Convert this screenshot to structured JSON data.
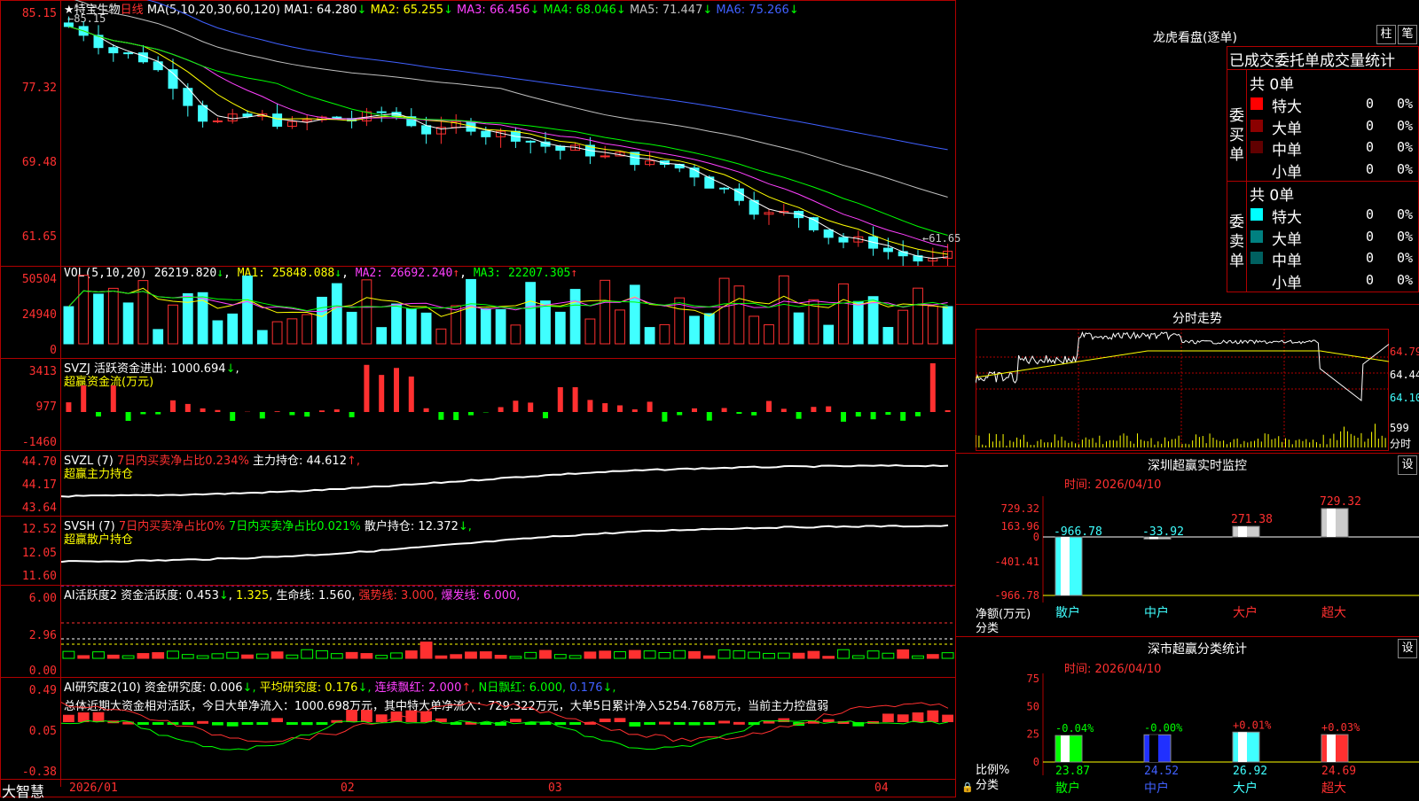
{
  "colors": {
    "up": "#ff3030",
    "down": "#40ffff",
    "bg": "#000000",
    "grid": "#b00000",
    "ma1": "#ffffff",
    "ma2": "#ffff00",
    "ma3": "#ff40ff",
    "ma4": "#00ff00",
    "ma5": "#c0c0c0",
    "ma6": "#4060ff"
  },
  "header": {
    "star": "★",
    "stock_name": "特宝生物",
    "period": "日线",
    "ma_params": "MA(5,10,20,30,60,120)",
    "ma_values": [
      {
        "label": "MA1:",
        "value": "64.280",
        "arrow": "↓"
      },
      {
        "label": "MA2:",
        "value": "65.255",
        "arrow": "↓"
      },
      {
        "label": "MA3:",
        "value": "66.456",
        "arrow": "↓"
      },
      {
        "label": "MA4:",
        "value": "68.046",
        "arrow": "↓"
      },
      {
        "label": "MA5:",
        "value": "71.447",
        "arrow": "↓"
      },
      {
        "label": "MA6:",
        "value": "75.266",
        "arrow": "↓"
      }
    ],
    "high_mark": "←85.15",
    "low_mark": "←61.65"
  },
  "price_axis": [
    "85.15",
    "77.32",
    "69.48",
    "61.65"
  ],
  "vol": {
    "title": "VOL(5,10,20)",
    "value": "26219.820",
    "arrow": "↓",
    "ma1": "MA1: 25848.088",
    "ma1_arrow": "↓",
    "ma2": "MA2: 26692.240",
    "ma2_arrow": "↑",
    "ma3": "MA3: 22207.305",
    "ma3_arrow": "↑",
    "axis": [
      "50504",
      "24940",
      "0"
    ]
  },
  "svzj": {
    "title": "SVZJ 活跃资金进出: 1000.694",
    "arrow": "↓",
    "sub": "超赢资金流(万元)",
    "axis": [
      "3413",
      "977",
      "-1460"
    ]
  },
  "svzl": {
    "title": "SVZL (7)",
    "t1": "7日内买卖净占比0.234%",
    "t2": "主力持仓: 44.612",
    "arrow": "↑,",
    "sub": "超赢主力持仓",
    "axis": [
      "44.70",
      "44.17",
      "43.64"
    ]
  },
  "svsh": {
    "title": "SVSH (7)",
    "t1": "7日内买卖净占比0%",
    "t2": "7日内买卖净占比0.021%",
    "t3": "散户持仓: 12.372",
    "arrow": "↓,",
    "sub": "超赢散户持仓",
    "axis": [
      "12.52",
      "12.05",
      "11.60"
    ]
  },
  "ai1": {
    "title": "AI活跃度2 资金活跃度: 0.453",
    "a1": "↓",
    "v2": "1.325",
    "v3": "生命线: 1.560,",
    "v4": "强势线: 3.000,",
    "v5": "爆发线: 6.000,",
    "axis": [
      "6.00",
      "2.96",
      "0.00"
    ]
  },
  "ai2": {
    "title": "AI研究度2(10) 资金研究度: 0.006",
    "a1": "↓,",
    "v2": "平均研究度: 0.176",
    "a2": "↓,",
    "v3": "连续飘红: 2.000",
    "a3": "↑,",
    "v4": "N日飘红: 6.000,",
    "v5": "0.176",
    "a5": "↓,",
    "summary": "总体近期大资金相对活跃，今日大单净流入：1000.698万元，其中特大单净流入：729.322万元，大单5日累计净入5254.768万元，当前主力控盘弱",
    "axis": [
      "0.49",
      "0.05",
      "-0.38"
    ]
  },
  "footer": {
    "brand": "大智慧",
    "dates": [
      "2026/01",
      "02",
      "03",
      "04"
    ]
  },
  "longhu": {
    "title": "龙虎看盘(逐单)",
    "btn1": "柱",
    "btn2": "笔",
    "header": "已成交委托单成交量统计",
    "buy": {
      "side": "委买单",
      "total": "共 0单",
      "rows": [
        {
          "name": "特大",
          "count": "0",
          "pct": "0%"
        },
        {
          "name": "大单",
          "count": "0",
          "pct": "0%"
        },
        {
          "name": "中单",
          "count": "0",
          "pct": "0%"
        },
        {
          "name": "小单",
          "count": "0",
          "pct": "0%"
        }
      ]
    },
    "sell": {
      "side": "委卖单",
      "total": "共 0单",
      "rows": [
        {
          "name": "特大",
          "count": "0",
          "pct": "0%"
        },
        {
          "name": "大单",
          "count": "0",
          "pct": "0%"
        },
        {
          "name": "中单",
          "count": "0",
          "pct": "0%"
        },
        {
          "name": "小单",
          "count": "0",
          "pct": "0%"
        }
      ]
    }
  },
  "intraday": {
    "title": "分时走势",
    "axis": [
      "64.79",
      "64.44",
      "64.10"
    ],
    "vol": "599",
    "vol_label": "分时"
  },
  "sz_monitor": {
    "title": "深圳超赢实时监控",
    "btn": "设",
    "time": "时间: 2026/04/10",
    "axis": [
      "729.32",
      "163.96",
      "0",
      "-401.41",
      "-966.78"
    ],
    "ylabel": "净额(万元)",
    "xlabel": "分类",
    "bars": [
      {
        "cat": "散户",
        "value": -966.78,
        "label": "-966.78"
      },
      {
        "cat": "中户",
        "value": -33.92,
        "label": "-33.92"
      },
      {
        "cat": "大户",
        "value": 271.38,
        "label": "271.38"
      },
      {
        "cat": "超大",
        "value": 729.32,
        "label": "729.32"
      }
    ]
  },
  "sz_class": {
    "title": "深市超赢分类统计",
    "btn": "设",
    "time": "时间: 2026/04/10",
    "axis": [
      "75",
      "50",
      "25",
      "0"
    ],
    "ylabel": "比例%",
    "xlabel": "分类",
    "bars": [
      {
        "cat": "散户",
        "value": 23.87,
        "change": "-0.04%"
      },
      {
        "cat": "中户",
        "value": 24.52,
        "change": "-0.00%"
      },
      {
        "cat": "大户",
        "value": 26.92,
        "change": "+0.01%"
      },
      {
        "cat": "超大",
        "value": 24.69,
        "change": "+0.03%"
      }
    ]
  },
  "chart_data": [
    {
      "type": "bar",
      "name": "sz_monitor",
      "categories": [
        "散户",
        "中户",
        "大户",
        "超大"
      ],
      "values": [
        -966.78,
        -33.92,
        271.38,
        729.32
      ],
      "ylabel": "净额(万元)",
      "xlabel": "分类",
      "ylim": [
        -966.78,
        729.32
      ]
    },
    {
      "type": "bar",
      "name": "sz_class",
      "categories": [
        "散户",
        "中户",
        "大户",
        "超大"
      ],
      "values": [
        23.87,
        24.52,
        26.92,
        24.69
      ],
      "ylabel": "比例%",
      "xlabel": "分类",
      "ylim": [
        0,
        75
      ]
    }
  ]
}
